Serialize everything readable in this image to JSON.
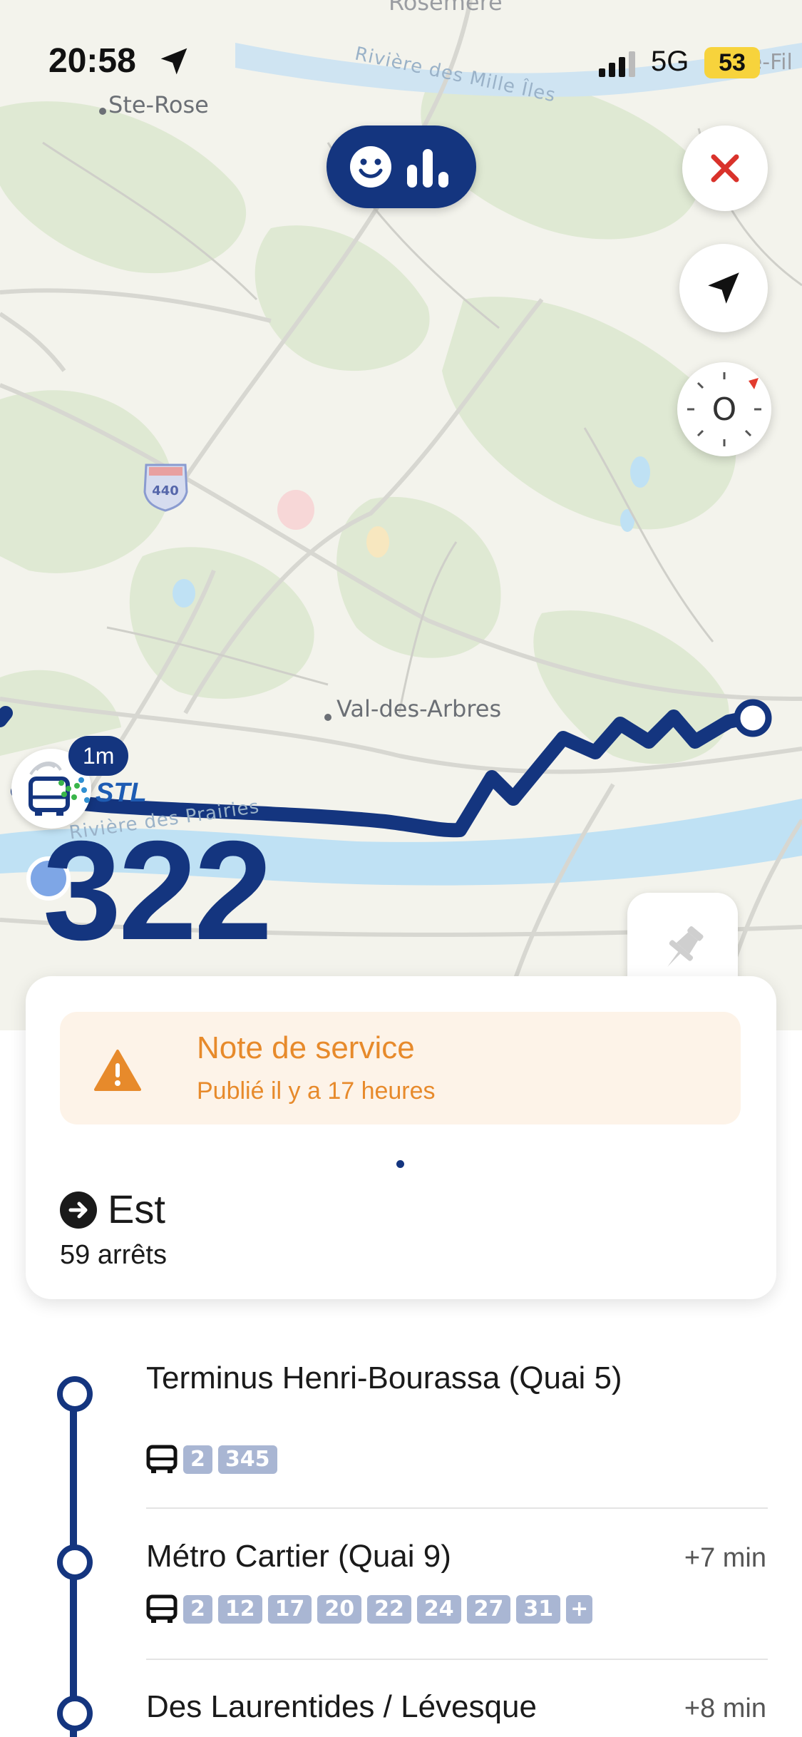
{
  "status_bar": {
    "time": "20:58",
    "network": "5G",
    "battery": "53"
  },
  "map": {
    "places": {
      "ste_rose": "Ste-Rose",
      "val_des_arbres": "Val-des-Arbres",
      "rosemere": "Rosemère",
      "ste_fil": "Ste-Fil"
    },
    "rivers": {
      "mille_iles": "Rivière des Mille Îles",
      "prairies": "Rivière des Prairies"
    },
    "highway_shield": "440",
    "compass_letter": "O",
    "icons": [
      "smiley-chart-icon",
      "close-icon",
      "navigation-arrow-icon",
      "compass-icon",
      "bus-icon",
      "pin-icon"
    ]
  },
  "route": {
    "number": "322",
    "eta_badge": "1m",
    "agency": "STL",
    "color": "#14357f"
  },
  "notice": {
    "title": "Note de service",
    "subtitle": "Publié il y a 17 heures",
    "color": "#e78a2b"
  },
  "direction": {
    "label": "Est",
    "stops": "59 arrêts"
  },
  "stops": [
    {
      "name": "Terminus Henri-Bourassa (Quai 5)",
      "offset": "",
      "lines": [
        "2",
        "345"
      ]
    },
    {
      "name": "Métro Cartier (Quai 9)",
      "offset": "+7 min",
      "lines": [
        "2",
        "12",
        "17",
        "20",
        "22",
        "24",
        "27",
        "31",
        "+"
      ]
    },
    {
      "name": "Des Laurentides / Lévesque",
      "offset": "+8 min",
      "lines": []
    }
  ]
}
